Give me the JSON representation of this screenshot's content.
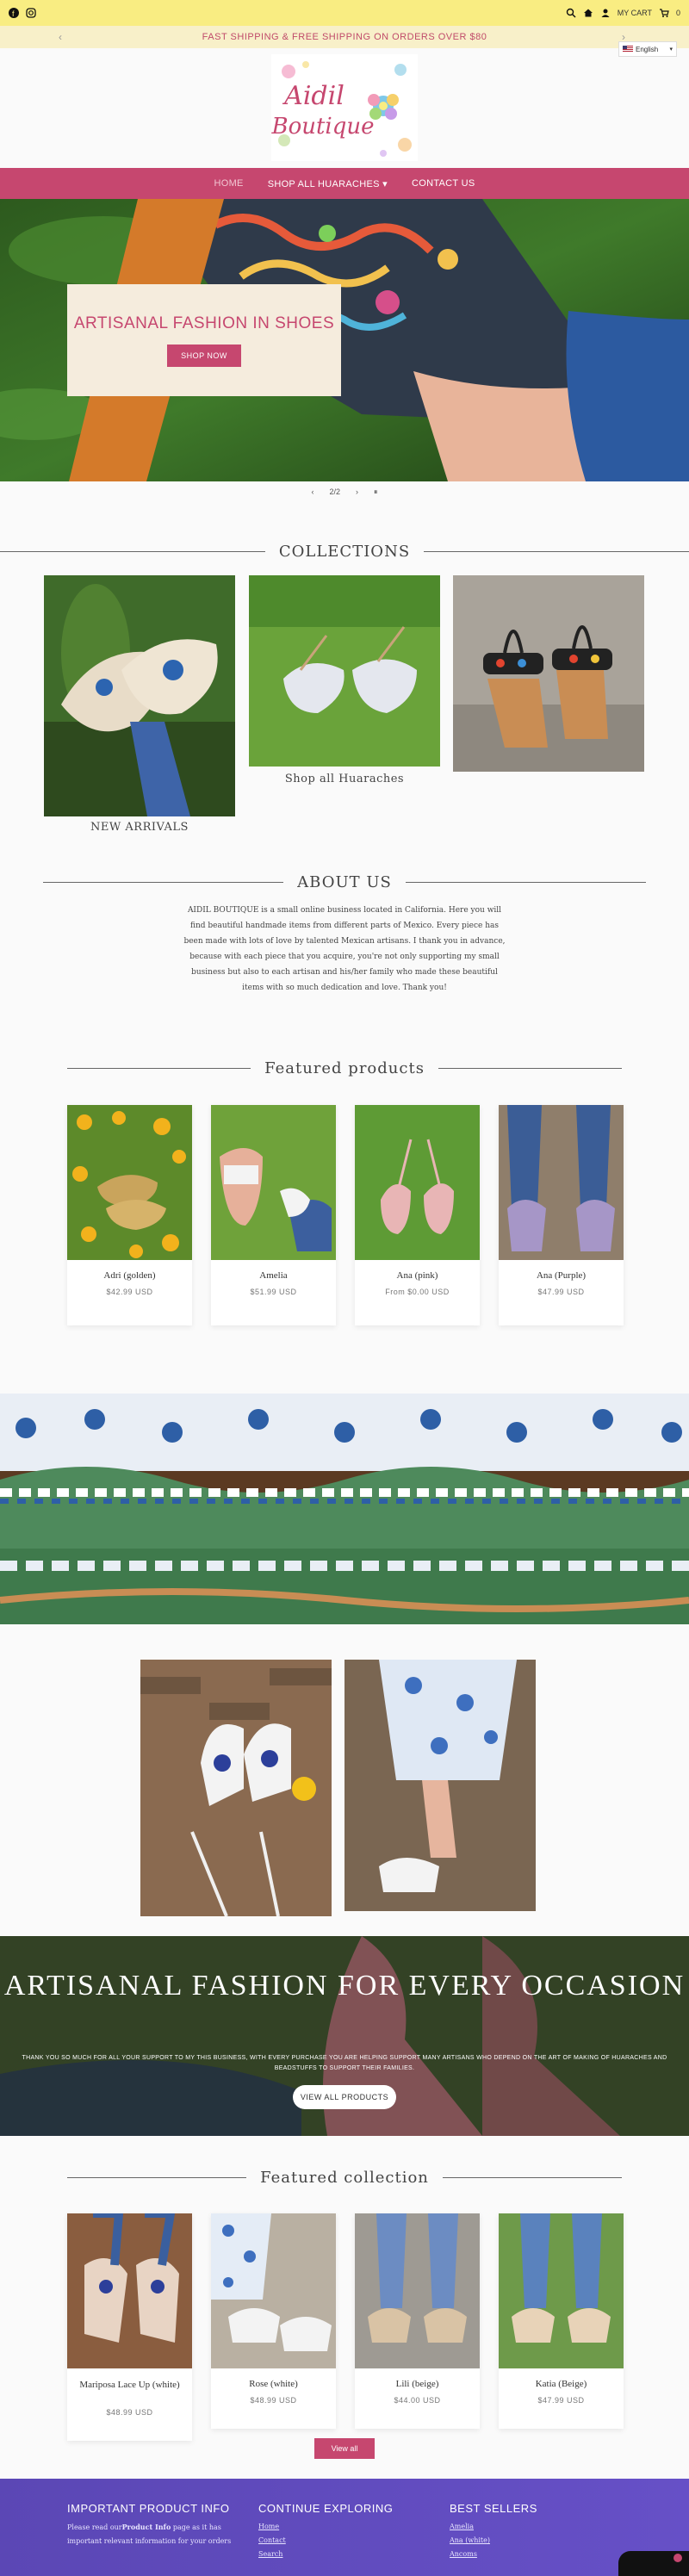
{
  "utility": {
    "social": [
      "facebook-icon",
      "instagram-icon"
    ],
    "cart_label": "MY CART",
    "cart_count": "0"
  },
  "announcement": {
    "text": "FAST SHIPPING & FREE SHIPPING ON ORDERS OVER $80",
    "prev": "‹",
    "next": "›"
  },
  "language": {
    "selected": "English"
  },
  "logo": {
    "line1": "Aidil",
    "line2": "Boutique"
  },
  "nav": {
    "items": [
      {
        "label": "HOME"
      },
      {
        "label": "SHOP ALL HUARACHES"
      },
      {
        "label": "CONTACT US"
      }
    ]
  },
  "hero": {
    "title": "ARTISANAL FASHION IN SHOES",
    "button": "SHOP NOW",
    "pager": "2/2",
    "prev": "‹",
    "next": "›",
    "pause": "⏸"
  },
  "collections": {
    "title": "COLLECTIONS",
    "items": [
      {
        "label": "NEW ARRIVALS"
      },
      {
        "label": "Shop all Huaraches"
      },
      {
        "label": ""
      }
    ]
  },
  "about": {
    "title": "ABOUT US",
    "body": "AIDIL BOUTIQUE is a small online business located in California. Here you will find beautiful handmade items from different parts of Mexico. Every piece has been made with lots of love by talented Mexican artisans. I thank you in advance, because with each piece that you acquire, you're not only supporting my small business but also to each artisan and his/her family who made these beautiful items with so much dedication and love. Thank you!"
  },
  "featured_products": {
    "title": "Featured products",
    "items": [
      {
        "name": "Adri (golden)",
        "price": "$42.99 USD"
      },
      {
        "name": "Amelia",
        "price": "$51.99 USD"
      },
      {
        "name": "Ana (pink)",
        "price": "From $0.00 USD"
      },
      {
        "name": "Ana (Purple)",
        "price": "$47.99 USD"
      }
    ]
  },
  "occasion": {
    "title": "ARTISANAL FASHION FOR EVERY OCCASION",
    "subtitle": "THANK YOU SO MUCH FOR ALL YOUR SUPPORT TO MY THIS BUSINESS, WITH EVERY PURCHASE YOU ARE HELPING SUPPORT MANY ARTISANS WHO DEPEND ON THE ART OF MAKING OF HUARACHES AND BEADSTUFFS TO SUPPORT THEIR FAMILIES.",
    "button": "VIEW ALL PRODUCTS"
  },
  "featured_collection": {
    "title": "Featured collection",
    "items": [
      {
        "name": "Mariposa Lace Up (white)",
        "price": "$48.99 USD"
      },
      {
        "name": "Rose (white)",
        "price": "$48.99 USD"
      },
      {
        "name": "Lili (beige)",
        "price": "$44.00 USD"
      },
      {
        "name": "Katia (Beige)",
        "price": "$47.99 USD"
      }
    ],
    "view_all": "View all"
  },
  "footer": {
    "col1": {
      "title": "IMPORTANT PRODUCT INFO",
      "text_pre": "Please read our",
      "text_bold": "Product Info",
      "text_post": "page as it has important relevant information for your orders"
    },
    "col2": {
      "title": "CONTINUE EXPLORING",
      "links": [
        "Home",
        "Contact",
        "Search"
      ]
    },
    "col3": {
      "title": "BEST SELLERS",
      "links": [
        "Amelia",
        "Ana (white)",
        "Ancoms"
      ]
    }
  },
  "colors": {
    "brand_pink": "#c6476f",
    "utility_yellow": "#f9ed82",
    "footer_purple": "#5b47b5"
  }
}
